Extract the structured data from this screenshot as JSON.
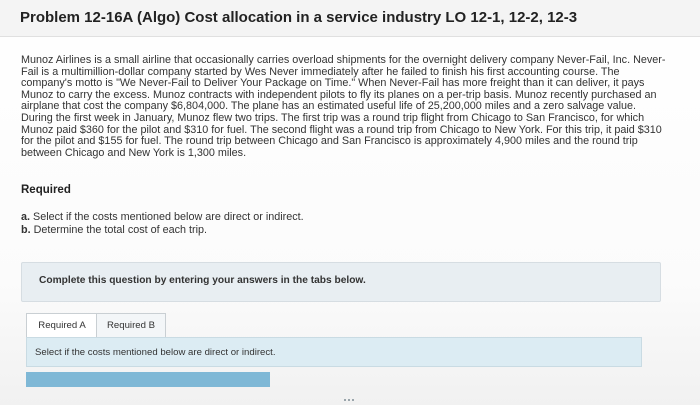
{
  "problem": {
    "title": "Problem 12-16A (Algo) Cost allocation in a service industry LO 12-1, 12-2, 12-3",
    "body": "Munoz Airlines is a small airline that occasionally carries overload shipments for the overnight delivery company Never-Fail, Inc. Never-Fail is a multimillion-dollar company started by Wes Never immediately after he failed to finish his first accounting course. The company's motto is \"We Never-Fail to Deliver Your Package on Time.\" When Never-Fail has more freight than it can deliver, it pays Munoz to carry the excess. Munoz contracts with independent pilots to fly its planes on a per-trip basis. Munoz recently purchased an airplane that cost the company $6,804,000. The plane has an estimated useful life of 25,200,000 miles and a zero salvage value. During the first week in January, Munoz flew two trips. The first trip was a round trip flight from Chicago to San Francisco, for which Munoz paid $360 for the pilot and $310 for fuel. The second flight was a round trip from Chicago to New York. For this trip, it paid $310 for the pilot and $155 for fuel. The round trip between Chicago and San Francisco is approximately 4,900 miles and the round trip between Chicago and New York is 1,300 miles."
  },
  "required": {
    "heading": "Required",
    "items": [
      {
        "letter": "a.",
        "text": "Select if the costs mentioned below are direct or indirect."
      },
      {
        "letter": "b.",
        "text": "Determine the total cost of each trip."
      }
    ]
  },
  "instructions": {
    "complete_text": "Complete this question by entering your answers in the tabs below."
  },
  "tabs": [
    {
      "label": "Required A"
    },
    {
      "label": "Required B"
    }
  ],
  "active_tab_instruction": "Select if the costs mentioned below are direct or indirect.",
  "colors": {
    "instruction_box": "#dcecf3",
    "progress_bar": "#7fb8d6",
    "complete_box": "#e8eef2"
  }
}
